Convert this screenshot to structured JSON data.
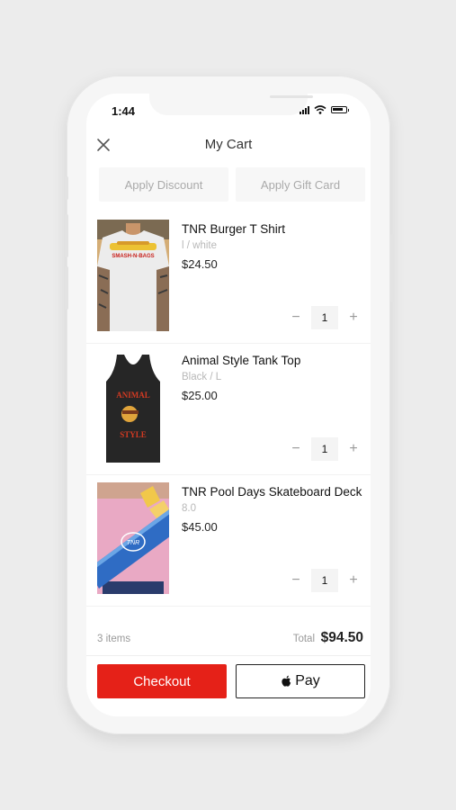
{
  "status": {
    "time": "1:44"
  },
  "header": {
    "title": "My Cart"
  },
  "actions": {
    "discount_label": "Apply Discount",
    "giftcard_label": "Apply Gift Card"
  },
  "cart": {
    "items": [
      {
        "name": "TNR Burger T Shirt",
        "variant": "l / white",
        "price": "$24.50",
        "qty": "1",
        "print": "SMASH-N-BAGS"
      },
      {
        "name": "Animal Style Tank Top",
        "variant": "Black / L",
        "price": "$25.00",
        "qty": "1",
        "print_top": "ANIMAL",
        "print_bottom": "STYLE"
      },
      {
        "name": "TNR Pool Days Skateboard Deck",
        "variant": "8.0",
        "price": "$45.00",
        "qty": "1",
        "print": "TNR"
      }
    ]
  },
  "summary": {
    "count": "3 items",
    "total_label": "Total",
    "total_value": "$94.50"
  },
  "buttons": {
    "checkout_label": "Checkout",
    "applepay_label": "Pay"
  },
  "colors": {
    "accent": "#e52118",
    "background": "#ececec"
  },
  "icons": {
    "close": "close-icon",
    "apple": "apple-logo-icon",
    "minus": "minus-icon",
    "plus": "plus-icon"
  }
}
